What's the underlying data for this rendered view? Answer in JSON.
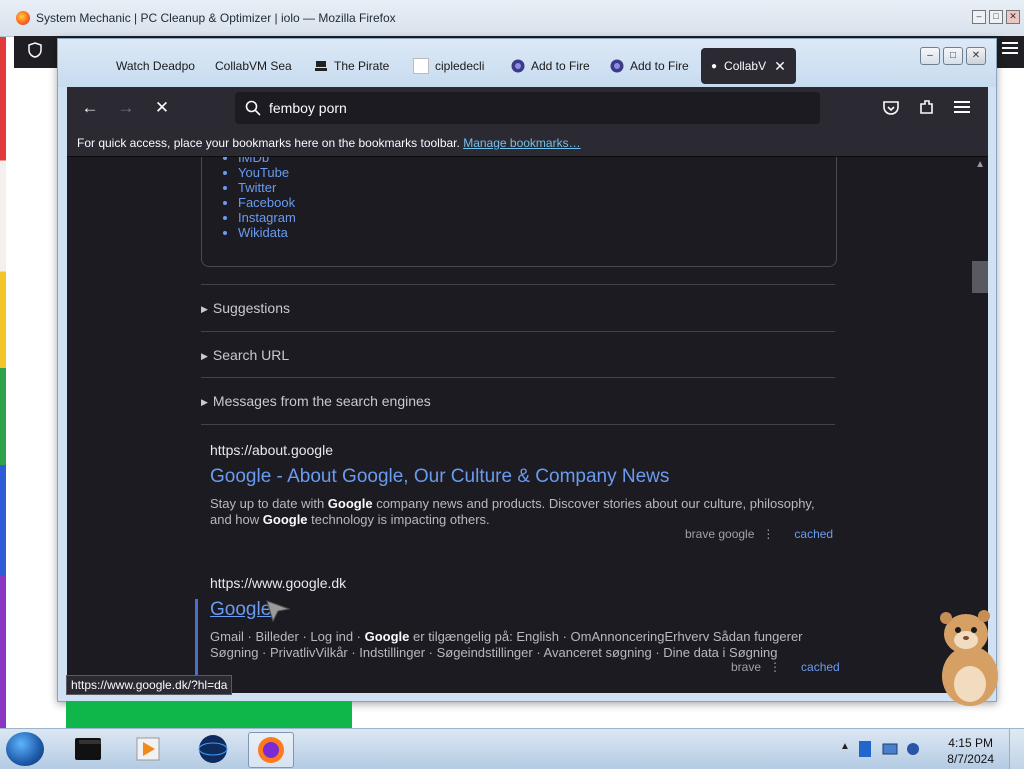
{
  "outer_window": {
    "title": "System Mechanic | PC Cleanup & Optimizer | iolo — Mozilla Firefox"
  },
  "tabs": [
    {
      "label": "Watch Deadpo",
      "icon": "none"
    },
    {
      "label": "CollabVM Sea",
      "icon": "none"
    },
    {
      "label": "The Pirate",
      "icon": "pirate-ship-icon"
    },
    {
      "label": "cipledecli",
      "icon": "blank-page-icon"
    },
    {
      "label": "Add to Fire",
      "icon": "addon-icon"
    },
    {
      "label": "Add to Fire",
      "icon": "addon-icon"
    },
    {
      "label": "CollabV",
      "icon": "loading-dot",
      "active": true
    }
  ],
  "toolbar": {
    "url_text": "femboy porn"
  },
  "bookmarks_bar": {
    "message": "For quick access, place your bookmarks here on the bookmarks toolbar.",
    "link": "Manage bookmarks…"
  },
  "infobox_links": [
    "IMDb",
    "YouTube",
    "Twitter",
    "Facebook",
    "Instagram",
    "Wikidata"
  ],
  "sections": [
    {
      "label": "Suggestions"
    },
    {
      "label": "Search URL"
    },
    {
      "label": "Messages from the search engines"
    }
  ],
  "results": [
    {
      "url": "https://about.google",
      "title": "Google - About Google, Our Culture & Company News",
      "desc_parts": [
        "Stay up to date with ",
        "Google",
        " company news and products. Discover stories about our culture, philosophy, and how ",
        "Google",
        " technology is impacting others."
      ],
      "engines": "brave  google",
      "cached": "cached"
    },
    {
      "url": "https://www.google.dk",
      "title": "Google",
      "desc_parts": [
        "Gmail · Billeder · Log ind · ",
        "Google",
        " er tilgængelig på: English · OmAnnonceringErhverv Sådan fungerer Søgning · PrivatlivVilkår · Indstillinger · Søgeindstillinger · Avanceret søgning · Dine data i Søgning"
      ],
      "engines": "brave",
      "cached": "cached"
    }
  ],
  "status_url": "https://www.google.dk/?hl=da",
  "clock": {
    "time": "4:15 PM",
    "date": "8/7/2024"
  },
  "colors": {
    "link": "#6a9bf0",
    "page_bg": "#1c1b22",
    "chrome": "#2b2a33",
    "green": "#0fb64a"
  }
}
